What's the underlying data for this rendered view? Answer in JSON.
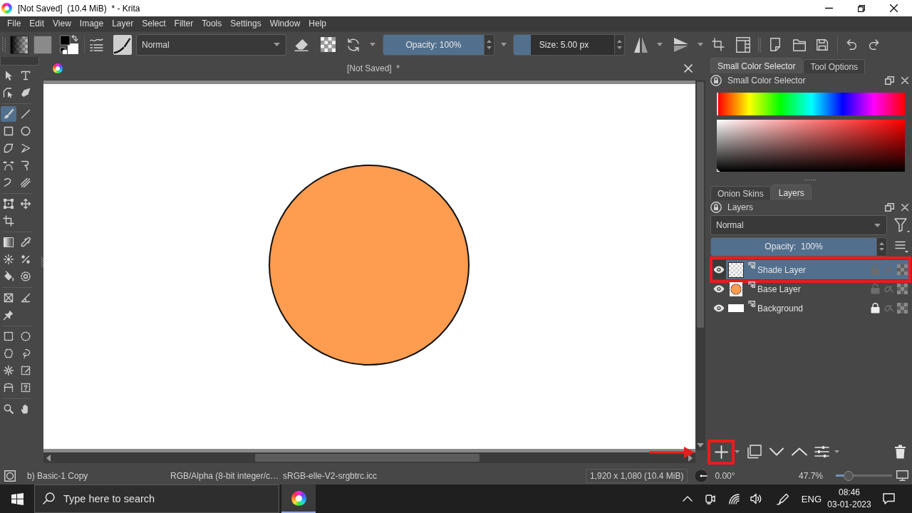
{
  "window": {
    "title": "[Not Saved]  (10.4 MiB)  * - Krita"
  },
  "menu_bar": [
    "File",
    "Edit",
    "View",
    "Image",
    "Layer",
    "Select",
    "Filter",
    "Tools",
    "Settings",
    "Window",
    "Help"
  ],
  "toolbar": {
    "blend_mode": "Normal",
    "opacity": {
      "label": "Opacity: 100%",
      "level": 1
    },
    "size": {
      "label": "Size: 5.00 px",
      "level": 0.17
    }
  },
  "toolbox": {
    "groups": [
      {
        "tools": [
          {
            "kind": "select_shapes",
            "selected": false
          },
          {
            "kind": "text",
            "selected": false
          },
          {
            "kind": "edit_shapes",
            "selected": false
          },
          {
            "kind": "calligraphy",
            "selected": false
          }
        ]
      },
      {
        "tools": [
          {
            "kind": "brush",
            "selected": true
          },
          {
            "kind": "line",
            "selected": false
          },
          {
            "kind": "rectangle",
            "selected": false
          },
          {
            "kind": "ellipse",
            "selected": false
          },
          {
            "kind": "polygon",
            "selected": false
          },
          {
            "kind": "polyline",
            "selected": false
          },
          {
            "kind": "bezier",
            "selected": false
          },
          {
            "kind": "freehand_path",
            "selected": false
          },
          {
            "kind": "dynamic_brush",
            "selected": false
          },
          {
            "kind": "multibrush",
            "selected": false
          }
        ]
      },
      {
        "tools": [
          {
            "kind": "transform",
            "selected": false
          },
          {
            "kind": "move",
            "selected": false
          },
          {
            "kind": "crop",
            "selected": false
          }
        ]
      },
      {
        "tools": [
          {
            "kind": "gradient",
            "selected": false
          },
          {
            "kind": "color_picker",
            "selected": false
          },
          {
            "kind": "smart_patch",
            "selected": false
          },
          {
            "kind": "colorize",
            "selected": false
          },
          {
            "kind": "fill",
            "selected": false
          },
          {
            "kind": "enclose_fill",
            "selected": false
          }
        ]
      },
      {
        "tools": [
          {
            "kind": "assistant",
            "selected": false
          },
          {
            "kind": "measure",
            "selected": false
          },
          {
            "kind": "reference",
            "selected": false
          }
        ]
      },
      {
        "tools": [
          {
            "kind": "rect_select",
            "selected": false
          },
          {
            "kind": "ellipse_select",
            "selected": false
          },
          {
            "kind": "polygon_select",
            "selected": false
          },
          {
            "kind": "freehand_select",
            "selected": false
          },
          {
            "kind": "contiguous_select",
            "selected": false
          },
          {
            "kind": "similar_select",
            "selected": false
          },
          {
            "kind": "bezier_select",
            "selected": false
          },
          {
            "kind": "magnetic_select",
            "selected": false
          }
        ]
      },
      {
        "tools": [
          {
            "kind": "zoom",
            "selected": false
          },
          {
            "kind": "pan",
            "selected": false
          }
        ]
      }
    ]
  },
  "document": {
    "title": "[Not Saved]  *",
    "shapes": [
      {
        "kind": "circle"
      }
    ]
  },
  "color_dock": {
    "tabs": [
      {
        "label": "Small Color Selector",
        "selected": true
      },
      {
        "label": "Tool Options",
        "selected": false
      }
    ],
    "title": "Small Color Selector"
  },
  "layers_dock": {
    "tabs": [
      {
        "label": "Onion Skins",
        "selected": false
      },
      {
        "label": "Layers",
        "selected": true
      }
    ],
    "title": "Layers",
    "blend_mode": "Normal",
    "opacity": {
      "label": "Opacity:  100%",
      "level": 1
    },
    "layers": [
      {
        "name": "Shade Layer",
        "thumbnail": {
          "kind": "empty"
        },
        "visible": true,
        "locked": false,
        "selected": true,
        "highlighted": true
      },
      {
        "name": "Base Layer",
        "thumbnail": {
          "kind": "circle"
        },
        "visible": true,
        "locked": false,
        "selected": false,
        "highlighted": false
      },
      {
        "name": "Background",
        "thumbnail": {
          "kind": "white"
        },
        "visible": true,
        "locked": true,
        "selected": false,
        "highlighted": false
      }
    ],
    "add_button": {
      "highlighted": true
    }
  },
  "annotation_arrow": true,
  "status_bar": {
    "brush_preset": "b) Basic-1 Copy",
    "color_model": "RGB/Alpha (8-bit integer/c…",
    "profile": "sRGB-elle-V2-srgbtrc.icc",
    "dimensions": "1,920 x 1,080 (10.4 MiB)",
    "rotation": "0.00°",
    "zoom": "47.7%",
    "zoom_slider": {
      "level": 0.23
    }
  },
  "taskbar": {
    "search": {
      "placeholder": "Type here to search"
    },
    "apps": [
      {
        "kind": "krita",
        "active": true
      }
    ],
    "language": "ENG",
    "time": "08:46",
    "date": "03-01-2023"
  }
}
